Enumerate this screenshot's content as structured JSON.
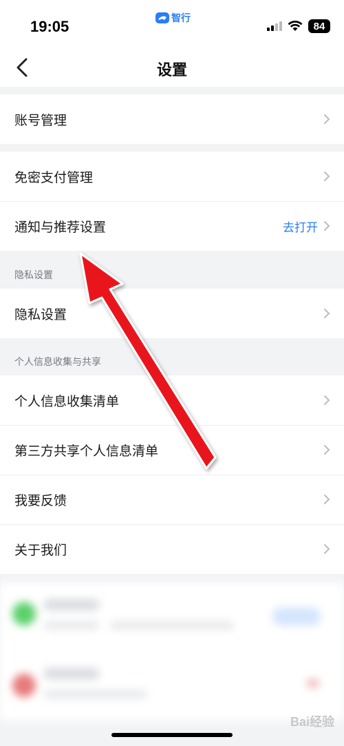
{
  "status_bar": {
    "time": "19:05",
    "app_name": "智行",
    "battery": "84"
  },
  "header": {
    "title": "设置"
  },
  "sections": {
    "account": {
      "items": [
        {
          "label": "账号管理"
        }
      ]
    },
    "payment_notify": {
      "items": [
        {
          "label": "免密支付管理"
        },
        {
          "label": "通知与推荐设置",
          "action": "去打开"
        }
      ]
    },
    "privacy": {
      "header": "隐私设置",
      "items": [
        {
          "label": "隐私设置"
        }
      ]
    },
    "personal_info": {
      "header": "个人信息收集与共享",
      "items": [
        {
          "label": "个人信息收集清单"
        },
        {
          "label": "第三方共享个人信息清单"
        },
        {
          "label": "我要反馈"
        },
        {
          "label": "关于我们"
        }
      ]
    }
  },
  "watermark": "Bai经验",
  "colors": {
    "accent": "#2a7df6",
    "background": "#f2f3f5",
    "annotation_arrow": "#e8141b"
  },
  "icons": [
    "back-arrow-icon",
    "chevron-right-icon",
    "signal-icon",
    "wifi-icon",
    "battery-icon"
  ]
}
